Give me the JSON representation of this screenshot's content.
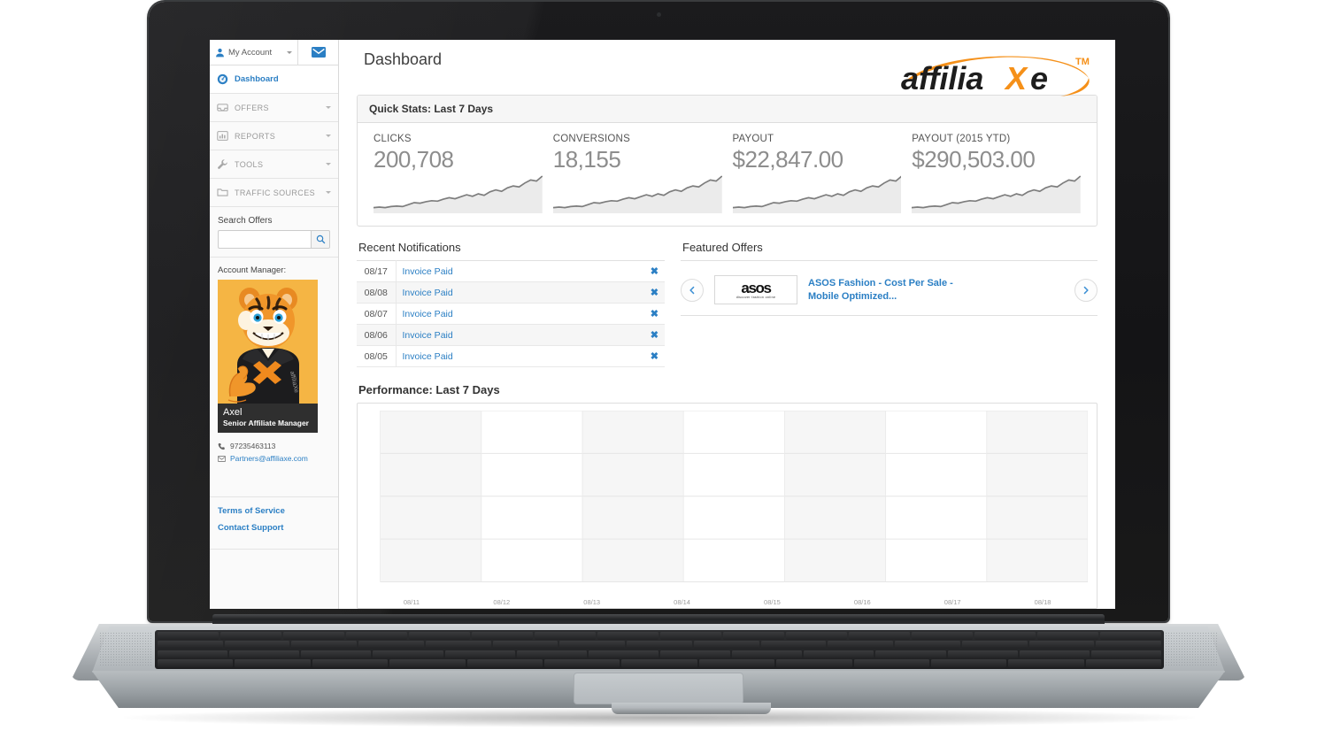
{
  "sidebar": {
    "account_label": "My Account",
    "mail_icon": "envelope-icon",
    "nav": [
      {
        "label": "Dashboard",
        "icon": "gauge-icon",
        "active": true,
        "caret": false
      },
      {
        "label": "OFFERS",
        "icon": "inbox-icon",
        "active": false,
        "caret": true
      },
      {
        "label": "REPORTS",
        "icon": "bar-chart-icon",
        "active": false,
        "caret": true
      },
      {
        "label": "TOOLS",
        "icon": "wrench-icon",
        "active": false,
        "caret": true
      },
      {
        "label": "TRAFFIC SOURCES",
        "icon": "folder-icon",
        "active": false,
        "caret": true
      }
    ],
    "search": {
      "label": "Search Offers",
      "value": "",
      "placeholder": "",
      "button_icon": "search-icon"
    },
    "account_manager": {
      "label": "Account Manager:",
      "name": "Axel",
      "role": "Senior Affiliate Manager",
      "phone": "97235463113",
      "phone_icon": "phone-icon",
      "email": "Partners@affiliaxe.com",
      "email_icon": "envelope-icon",
      "avatar": "tiger-mascot-thumbs-up"
    },
    "footer_links": [
      "Terms of Service",
      "Contact Support"
    ]
  },
  "header": {
    "title": "Dashboard",
    "logo": {
      "text_dark_1": "affilia",
      "text_accent": "X",
      "text_dark_2": "e",
      "tm": "TM",
      "accent_color": "#f59019",
      "dark_color": "#1d1d1d"
    }
  },
  "quick_stats": {
    "panel_title": "Quick Stats: Last 7 Days",
    "items": [
      {
        "label": "CLICKS",
        "value": "200,708"
      },
      {
        "label": "CONVERSIONS",
        "value": "18,155"
      },
      {
        "label": "PAYOUT",
        "value": "$22,847.00"
      },
      {
        "label": "PAYOUT (2015 YTD)",
        "value": "$290,503.00"
      }
    ]
  },
  "notifications": {
    "title": "Recent Notifications",
    "close_glyph": "✖",
    "rows": [
      {
        "date": "08/17",
        "message": "Invoice Paid"
      },
      {
        "date": "08/08",
        "message": "Invoice Paid"
      },
      {
        "date": "08/07",
        "message": "Invoice Paid"
      },
      {
        "date": "08/06",
        "message": "Invoice Paid"
      },
      {
        "date": "08/05",
        "message": "Invoice Paid"
      }
    ]
  },
  "featured_offers": {
    "title": "Featured Offers",
    "prev_icon": "chevron-left-icon",
    "next_icon": "chevron-right-icon",
    "offer": {
      "logo_text": "asos",
      "logo_tagline": "discover fashion online",
      "name": "ASOS Fashion - Cost Per Sale - Mobile Optimized..."
    }
  },
  "performance": {
    "title": "Performance: Last 7 Days"
  },
  "chart_data": {
    "type": "line",
    "title": "Performance: Last 7 Days",
    "xlabel": "",
    "ylabel": "",
    "x": [
      "08/11",
      "08/12",
      "08/13",
      "08/14",
      "08/15",
      "08/16",
      "08/17",
      "08/18"
    ],
    "series": [],
    "grid": true,
    "legend": "none",
    "band_shading": "alternating-vertical",
    "y_gridlines": 4,
    "note": "Empty plot area — no data series rendered; only alternating vertical bands and gridlines visible.",
    "sparklines": [
      {
        "name": "CLICKS",
        "type": "area",
        "values": [
          8,
          9,
          8,
          10,
          11,
          10,
          14,
          18,
          17,
          20,
          22,
          21,
          25,
          28,
          26,
          30,
          34,
          31,
          36,
          33,
          40,
          44,
          41,
          48,
          52,
          50,
          58,
          64,
          62,
          72
        ]
      },
      {
        "name": "CONVERSIONS",
        "type": "area",
        "values": [
          8,
          9,
          8,
          10,
          11,
          10,
          14,
          18,
          17,
          20,
          22,
          21,
          25,
          28,
          26,
          30,
          34,
          31,
          36,
          33,
          40,
          44,
          41,
          48,
          52,
          50,
          58,
          64,
          62,
          72
        ]
      },
      {
        "name": "PAYOUT",
        "type": "area",
        "values": [
          8,
          9,
          8,
          10,
          11,
          10,
          14,
          18,
          17,
          20,
          22,
          21,
          25,
          28,
          26,
          30,
          34,
          31,
          36,
          33,
          40,
          44,
          41,
          48,
          52,
          50,
          58,
          64,
          62,
          72
        ]
      },
      {
        "name": "PAYOUT (2015 YTD)",
        "type": "area",
        "values": [
          8,
          9,
          8,
          10,
          11,
          10,
          14,
          18,
          17,
          20,
          22,
          21,
          25,
          28,
          26,
          30,
          34,
          31,
          36,
          33,
          40,
          44,
          41,
          48,
          52,
          50,
          58,
          64,
          62,
          72
        ]
      }
    ]
  },
  "colors": {
    "accent_blue": "#2b7fc4",
    "brand_orange": "#f59019",
    "muted_gray": "#8d8d8d"
  }
}
